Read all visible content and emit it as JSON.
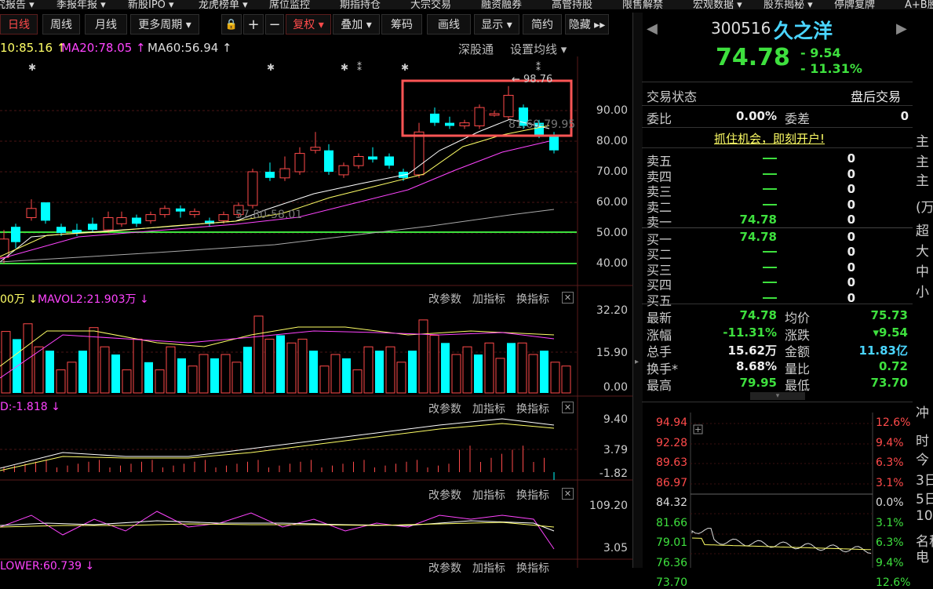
{
  "top_menu": [
    "究报告 ▾",
    "季报年报 ▾",
    "新股IPO ▾",
    "龙虎榜单 ▾",
    "席位监控",
    "期指持仓",
    "大宗交易",
    "融资融券",
    "高管持股",
    "限售解禁",
    "宏观数据 ▾",
    "股东揭秘 ▾",
    "停牌复牌",
    "A+B股"
  ],
  "toolbar": {
    "daily": "日线",
    "weekly": "周线",
    "monthly": "月线",
    "more_periods": "更多周期 ▾",
    "lock": "🔒",
    "plus": "+",
    "minus": "−",
    "restore_rights": "复权 ▾",
    "overlay": "叠加 ▾",
    "chips": "筹码",
    "draw": "画线",
    "display": "显示 ▾",
    "simple": "简约",
    "hide": "隐藏 ▸▸"
  },
  "ma_line": {
    "ma10": "10:85.16 ↑",
    "ma20": "MA20:78.05 ↑",
    "ma60": "MA60:56.94 ↑",
    "link": "深股通",
    "settings": "设置均线 ▾"
  },
  "kline": {
    "price_axis": [
      "90.00",
      "80.00",
      "70.00",
      "60.00",
      "50.00",
      "40.00"
    ],
    "high_label": "← 98.76",
    "range_label": "57.80-58.01",
    "ma_overlay_label": "81.60-79.95"
  },
  "volume_panel": {
    "label1": "00万 ↓",
    "label2": "MAVOL2:21.903万 ↓",
    "btn1": "改参数",
    "btn2": "加指标",
    "btn3": "换指标",
    "axis": [
      "32.20",
      "15.90",
      "0.00"
    ]
  },
  "macd_panel": {
    "label": "D:-1.818 ↓",
    "btn1": "改参数",
    "btn2": "加指标",
    "btn3": "换指标",
    "axis": [
      "9.40",
      "3.79",
      "-1.82"
    ]
  },
  "kdj_panel": {
    "btn1": "改参数",
    "btn2": "加指标",
    "btn3": "换指标",
    "axis": [
      "109.20",
      "3.05"
    ]
  },
  "bottom_panel": {
    "label": "LOWER:60.739 ↓",
    "btn1": "改参数",
    "btn2": "加指标",
    "btn3": "换指标"
  },
  "stock": {
    "code": "300516",
    "name": "久之洋",
    "price": "74.78",
    "change": "- 9.54",
    "change_pct": "- 11.31%"
  },
  "status": {
    "label": "交易状态",
    "value": "盘后交易"
  },
  "commission": {
    "ratio_label": "委比",
    "ratio": "0.00%",
    "diff_label": "委差",
    "diff": "0"
  },
  "promo": "抓住机会，即刻开户!",
  "order_book": {
    "asks": [
      {
        "label": "卖五",
        "price": "—",
        "vol": "0"
      },
      {
        "label": "卖四",
        "price": "—",
        "vol": "0"
      },
      {
        "label": "卖三",
        "price": "—",
        "vol": "0"
      },
      {
        "label": "卖二",
        "price": "—",
        "vol": "0"
      },
      {
        "label": "卖一",
        "price": "74.78",
        "vol": "0"
      }
    ],
    "bids": [
      {
        "label": "买一",
        "price": "74.78",
        "vol": "0"
      },
      {
        "label": "买二",
        "price": "—",
        "vol": "0"
      },
      {
        "label": "买三",
        "price": "—",
        "vol": "0"
      },
      {
        "label": "买四",
        "price": "—",
        "vol": "0"
      },
      {
        "label": "买五",
        "price": "—",
        "vol": "0"
      }
    ]
  },
  "stats": [
    {
      "l1": "最新",
      "v1": "74.78",
      "l2": "均价",
      "v2": "75.73"
    },
    {
      "l1": "涨幅",
      "v1": "-11.31%",
      "l2": "涨跌",
      "v2": "▾9.54"
    },
    {
      "l1": "总手",
      "v1": "15.62万",
      "l2": "金额",
      "v2": "11.83亿"
    },
    {
      "l1": "换手*",
      "v1": "8.68%",
      "l2": "量比",
      "v2": "0.72"
    },
    {
      "l1": "最高",
      "v1": "79.95",
      "l2": "最低",
      "v2": "73.70"
    }
  ],
  "intraday": {
    "left_axis": [
      "94.94",
      "92.28",
      "89.63",
      "86.97",
      "84.32",
      "81.66",
      "79.01",
      "76.36",
      "73.70"
    ],
    "right_axis": [
      "12.6%",
      "9.4%",
      "6.3%",
      "3.1%",
      "0.0%",
      "3.1%",
      "6.3%",
      "9.4%",
      "12.6%"
    ]
  },
  "far_right": [
    "主",
    "主",
    "主",
    "(万元",
    "超",
    "大",
    "中",
    "小",
    "冲",
    "时",
    "今",
    "3日",
    "5日",
    "10",
    "名称",
    "电"
  ],
  "colors": {
    "up": "#ff4a4a",
    "down": "#00ffff",
    "ma5": "#ffffff",
    "ma10": "#ffff66",
    "ma20": "#ff44ff",
    "ma60": "#cccccc",
    "highlight": "#ff5555",
    "green": "#3ee03e"
  }
}
